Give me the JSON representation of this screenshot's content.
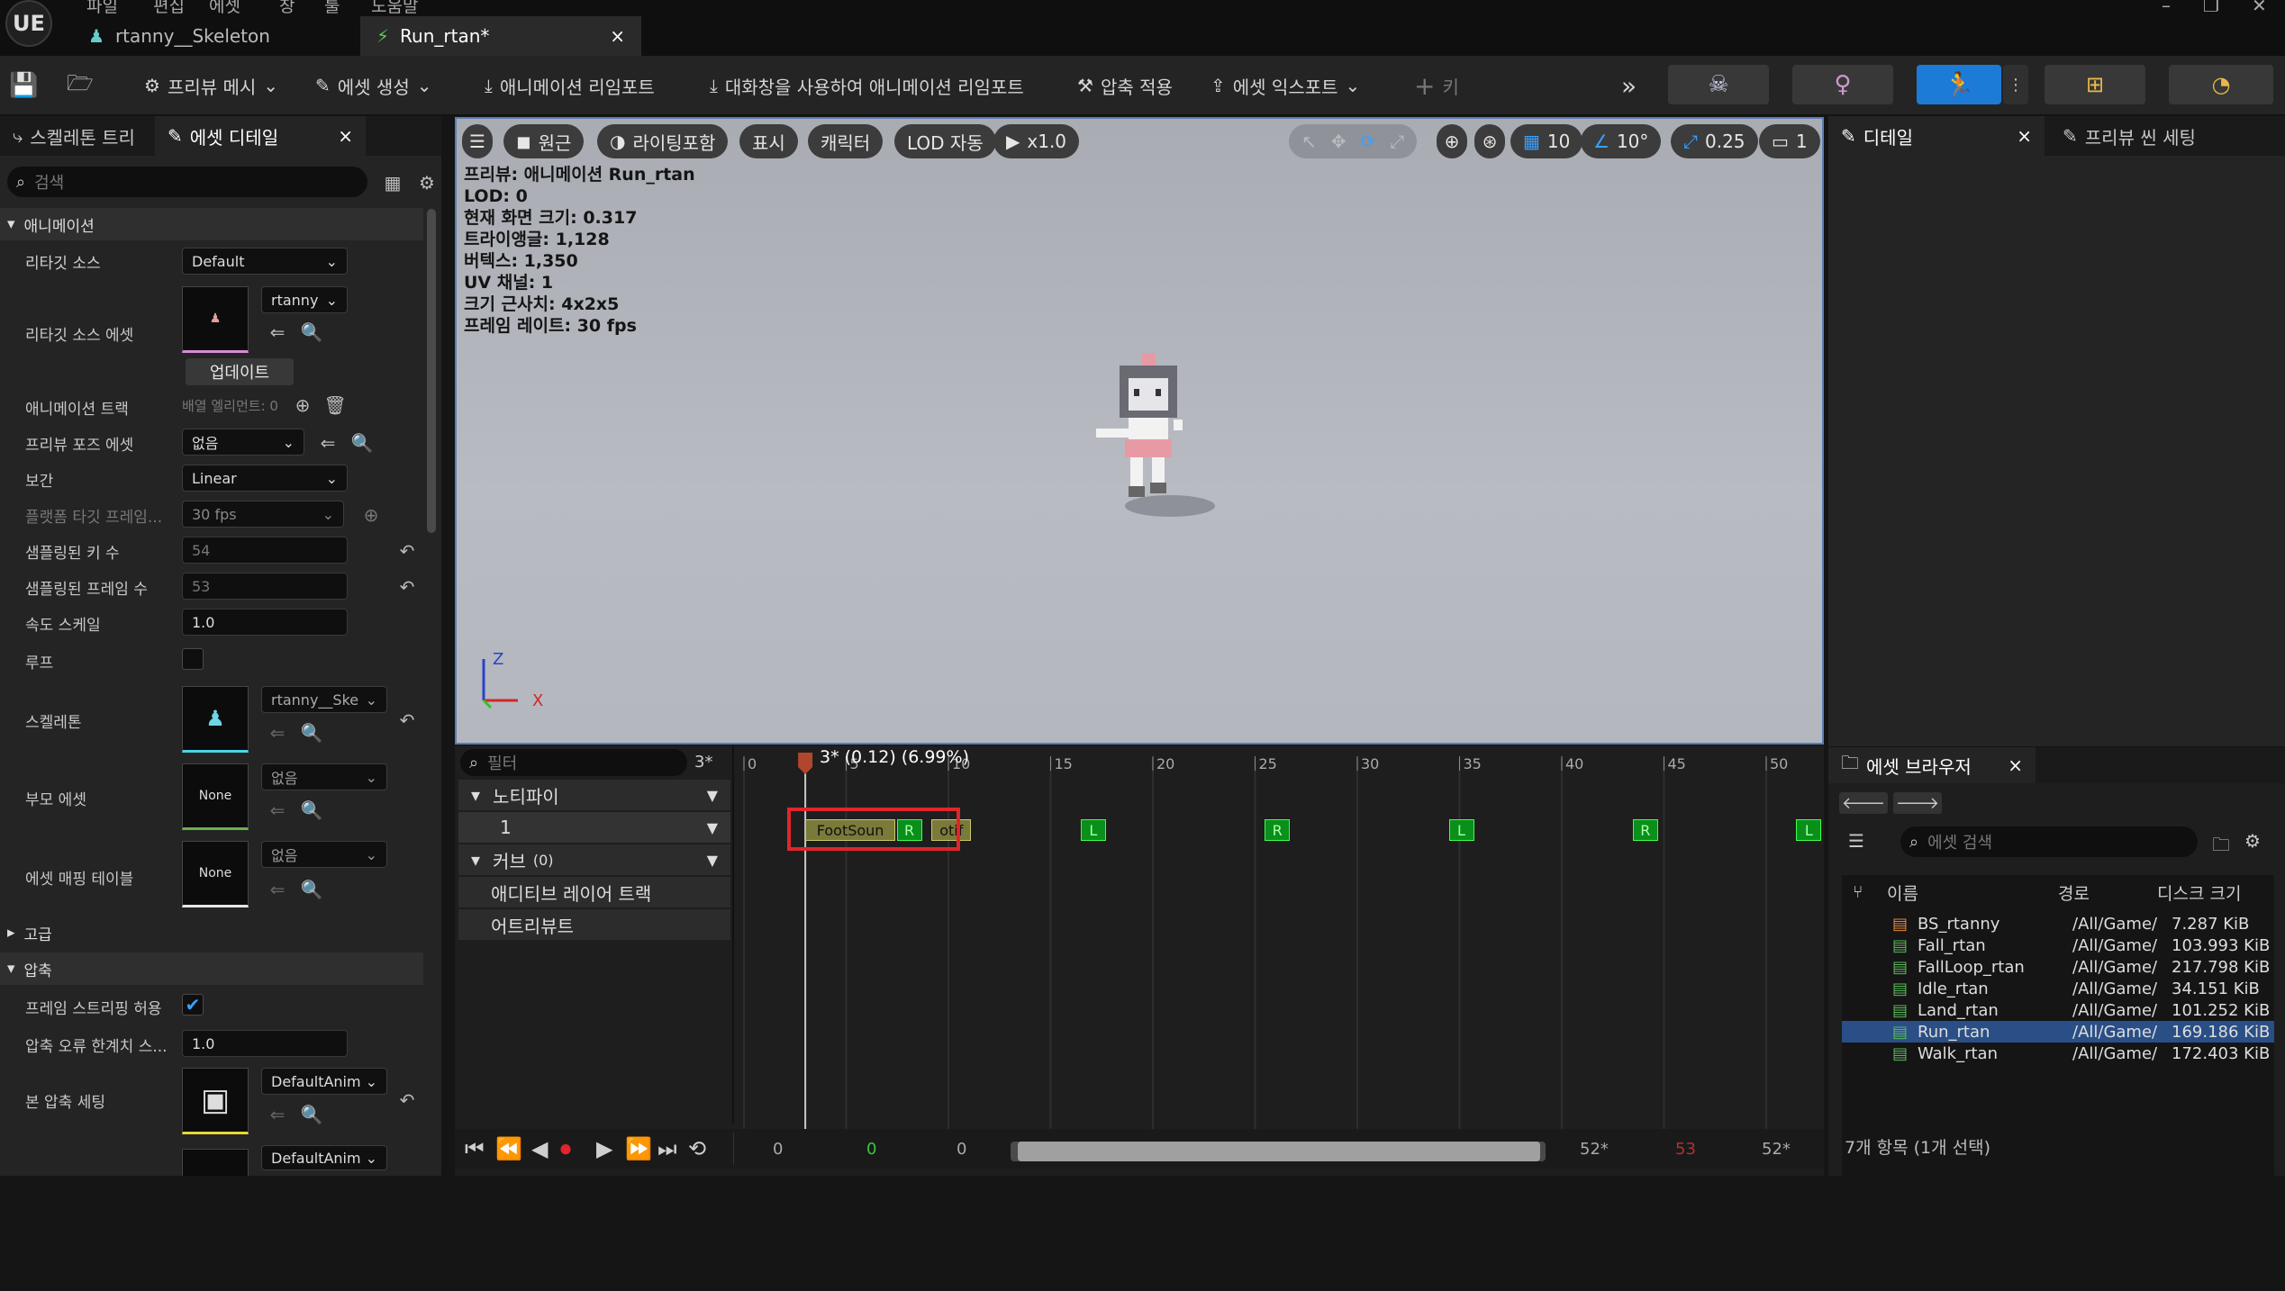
{
  "app": {
    "logo": "UE",
    "menu": [
      "파일",
      "편집",
      "에셋",
      "창",
      "툴",
      "도움말"
    ],
    "tabs": [
      {
        "label": "rtanny__Skeleton",
        "icon": "skeleton-icon"
      },
      {
        "label": "Run_rtan*",
        "icon": "animation-icon",
        "close": "×"
      }
    ]
  },
  "toolbar": {
    "preview_mesh": "프리뷰 메시",
    "create_asset": "에셋 생성",
    "reimport": "애니메이션 리임포트",
    "reimport_dialog": "대화창을 사용하여 애니메이션 리임포트",
    "apply_compression": "압축 적용",
    "export_asset": "에셋 익스포트",
    "key": "키"
  },
  "left_panel": {
    "tabs": [
      "스켈레톤 트리",
      "에셋 디테일"
    ],
    "close": "×",
    "search_placeholder": "검색",
    "sections": {
      "animation": "애니메이션",
      "advanced": "고급",
      "compression": "압축"
    },
    "props": {
      "retarget_source": {
        "label": "리타깃 소스",
        "value": "Default"
      },
      "retarget_source_asset": {
        "label": "리타깃 소스 에셋",
        "value": "rtanny",
        "button": "업데이트"
      },
      "animation_track": {
        "label": "애니메이션 트랙",
        "value": "배열 엘리먼트: 0"
      },
      "preview_pose": {
        "label": "프리뷰 포즈 에셋",
        "value": "없음"
      },
      "interpolation": {
        "label": "보간",
        "value": "Linear"
      },
      "platform_frame": {
        "label": "플랫폼 타깃 프레임...",
        "value": "30 fps"
      },
      "sampled_keys": {
        "label": "샘플링된 키 수",
        "value": "54"
      },
      "sampled_frames": {
        "label": "샘플링된 프레임 수",
        "value": "53"
      },
      "rate_scale": {
        "label": "속도 스케일",
        "value": "1.0"
      },
      "loop": {
        "label": "루프"
      },
      "skeleton": {
        "label": "스켈레톤",
        "value": "rtanny__Ske"
      },
      "parent_asset": {
        "label": "부모 에셋",
        "value": "없음",
        "thumb": "None"
      },
      "asset_mapping": {
        "label": "에셋 매핑 테이블",
        "value": "없음",
        "thumb": "None"
      },
      "frame_stripping": {
        "label": "프레임 스트리핑 허용"
      },
      "error_threshold": {
        "label": "압축 오류 한계치 스...",
        "value": "1.0"
      },
      "bone_compression": {
        "label": "본 압축 세팅",
        "value": "DefaultAnim"
      },
      "curve_compression": {
        "value": "DefaultAnim"
      }
    }
  },
  "viewport": {
    "buttons": {
      "perspective": "원근",
      "lighting": "라이팅포함",
      "show": "표시",
      "character": "캐릭터",
      "lod": "LOD 자동",
      "speed": "x1.0",
      "grid": "10",
      "angle": "10°",
      "scale": "0.25",
      "camera": "1"
    },
    "info": [
      "프리뷰: 애니메이션 Run_rtan",
      "LOD: 0",
      "현재 화면 크기: 0.317",
      "트라이앵글: 1,128",
      "버텍스: 1,350",
      "UV 채널: 1",
      "크기 근사치: 4x2x5",
      "프레임 레이트: 30 fps"
    ],
    "axis": {
      "z": "Z",
      "x": "X"
    }
  },
  "timeline": {
    "filter_placeholder": "필터",
    "frame_marker": "3*",
    "playhead_label": "3* (0.12) (6.99%)",
    "ticks": [
      "0",
      "5",
      "10",
      "15",
      "20",
      "25",
      "30",
      "35",
      "40",
      "45",
      "50"
    ],
    "tracks": {
      "notifies": "노티파이",
      "track1": "1",
      "curves": "커브",
      "curves_count": "(0)",
      "additive": "애디티브 레이어 트랙",
      "attributes": "어트리뷰트"
    },
    "notifies": [
      {
        "label": "FootSoun",
        "frame": 3
      },
      {
        "label": "R",
        "frame": 8
      },
      {
        "label": "otif",
        "frame": 9
      },
      {
        "label": "L",
        "frame": 17
      },
      {
        "label": "R",
        "frame": 26
      },
      {
        "label": "L",
        "frame": 35
      },
      {
        "label": "R",
        "frame": 44
      },
      {
        "label": "L",
        "frame": 52
      }
    ],
    "transport": {
      "start": "0",
      "current": "0",
      "current2": "0",
      "end": "52*",
      "end_red": "53",
      "end2": "52*"
    }
  },
  "right_panel": {
    "tabs": [
      "디테일",
      "프리뷰 씬 세팅"
    ],
    "close": "×"
  },
  "asset_browser": {
    "title": "에셋 브라우저",
    "close": "×",
    "search_placeholder": "에셋 검색",
    "columns": [
      "이름",
      "경로",
      "디스크 크기"
    ],
    "items": [
      {
        "name": "BS_rtanny",
        "path": "/All/Game/",
        "size": "7.287 KiB",
        "type": "blendspace"
      },
      {
        "name": "Fall_rtan",
        "path": "/All/Game/",
        "size": "103.993 KiB",
        "type": "anim"
      },
      {
        "name": "FallLoop_rtan",
        "path": "/All/Game/",
        "size": "217.798 KiB",
        "type": "anim"
      },
      {
        "name": "Idle_rtan",
        "path": "/All/Game/",
        "size": "34.151 KiB",
        "type": "anim"
      },
      {
        "name": "Land_rtan",
        "path": "/All/Game/",
        "size": "101.252 KiB",
        "type": "anim"
      },
      {
        "name": "Run_rtan",
        "path": "/All/Game/",
        "size": "169.186 KiB",
        "type": "anim",
        "selected": true
      },
      {
        "name": "Walk_rtan",
        "path": "/All/Game/",
        "size": "172.403 KiB",
        "type": "anim"
      }
    ],
    "status": "7개 항목 (1개 선택)"
  },
  "colors": {
    "accent": "#1d7bd8",
    "notify_green": "#0a8f1a",
    "highlight_red": "#e0252b",
    "playhead": "#b0462e"
  }
}
